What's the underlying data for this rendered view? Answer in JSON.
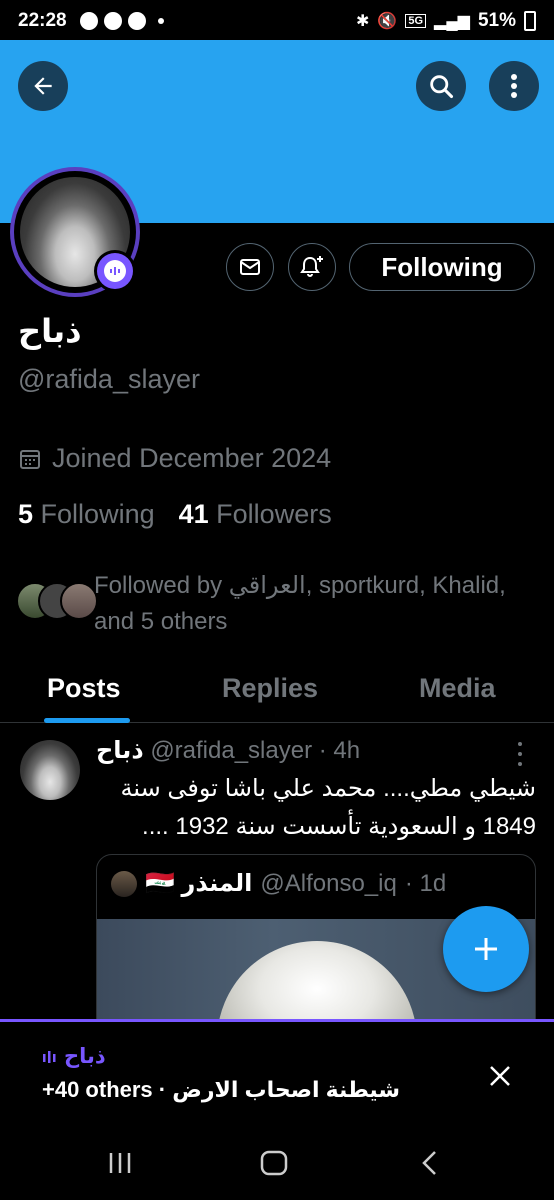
{
  "status_bar": {
    "time": "22:28",
    "network": "5G",
    "battery": "51%"
  },
  "profile": {
    "display_name": "ذباح",
    "handle": "@rafida_slayer",
    "joined": "Joined December 2024",
    "following_count": "5",
    "following_label": "Following",
    "followers_count": "41",
    "followers_label": "Followers",
    "followed_by": "Followed by العراقي, sportkurd, Khalid, and 5 others",
    "follow_button_label": "Following"
  },
  "tabs": [
    {
      "label": "Posts",
      "active": true
    },
    {
      "label": "Replies",
      "active": false
    },
    {
      "label": "Media",
      "active": false
    }
  ],
  "post": {
    "author_name": "ذباح",
    "author_handle": "@rafida_slayer",
    "time": "· 4h",
    "text": "شيطي مطي.... محمد علي باشا توفى سنة 1849 و السعودية تأسست سنة 1932 ....",
    "quote": {
      "author_name": "المنذر 🇮🇶",
      "author_handle": "@Alfonso_iq",
      "time": "· 1d"
    }
  },
  "space_bar": {
    "host": "ذباح",
    "title_text": "شيطنة اصحاب الارض",
    "others": "+40 others ·"
  },
  "colors": {
    "banner": "#27a3f0",
    "accent": "#1d9bf0",
    "spaces": "#7856ff",
    "muted": "#71767b"
  }
}
